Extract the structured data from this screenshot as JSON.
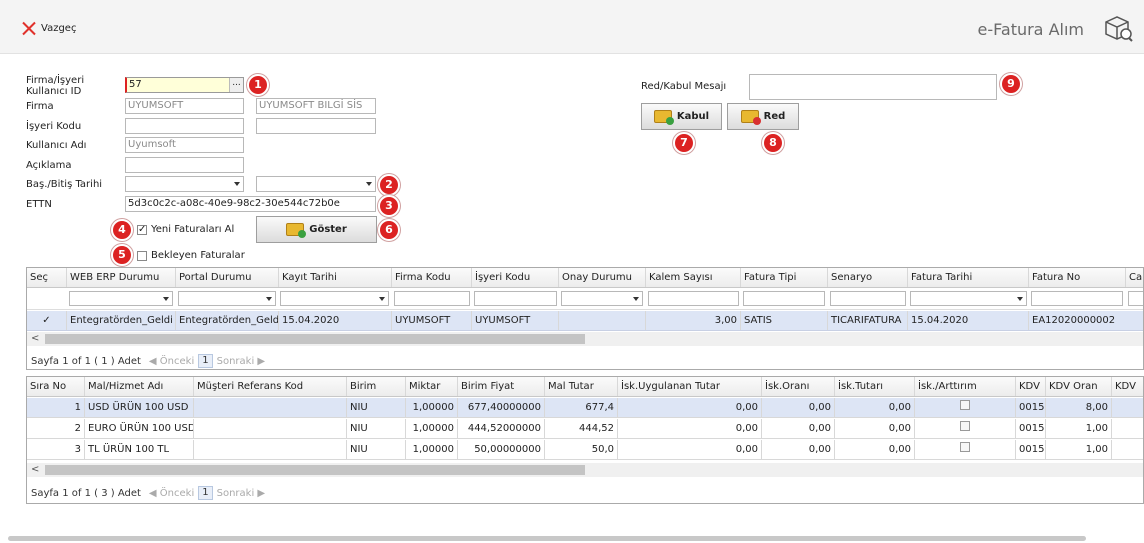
{
  "toolbar": {
    "cancel_label": "Vazgeç",
    "title": "e-Fatura Alım"
  },
  "form": {
    "firma_isyeri_label": "Firma/İşyeri Kullanıcı ID",
    "firma_isyeri_value": "57",
    "firma_label": "Firma",
    "firma_code": "UYUMSOFT",
    "firma_name": "UYUMSOFT BILGİ SİS",
    "isyeri_label": "İşyeri Kodu",
    "kullanici_label": "Kullanıcı Adı",
    "kullanici_value": "Uyumsoft",
    "aciklama_label": "Açıklama",
    "tarih_label": "Baş./Bitiş Tarihi",
    "ettn_label": "ETTN",
    "ettn_value": "5d3c0c2c-a08c-40e9-98c2-30e544c72b0e",
    "yeni_label": "Yeni Faturaları Al",
    "yeni_checked": "✓",
    "bekleyen_label": "Bekleyen Faturalar",
    "goster_label": "Göster",
    "mesaj_label": "Red/Kabul Mesajı",
    "kabul_label": "Kabul",
    "red_label": "Red"
  },
  "badges": [
    "1",
    "2",
    "3",
    "4",
    "5",
    "6",
    "7",
    "8",
    "9"
  ],
  "grid1": {
    "headers": [
      "Seç",
      "WEB ERP Durumu",
      "Portal Durumu",
      "Kayıt Tarihi",
      "Firma Kodu",
      "İşyeri Kodu",
      "Onay Durumu",
      "Kalem Sayısı",
      "Fatura Tipi",
      "Senaryo",
      "Fatura Tarihi",
      "Fatura No",
      "Ca"
    ],
    "row": {
      "sec": "✓",
      "web_erp": "Entegratörden_Geldi",
      "portal": "Entegratörden_Geldi",
      "kayit_tarihi": "15.04.2020",
      "firma_kodu": "UYUMSOFT",
      "isyeri_kodu": "UYUMSOFT",
      "onay": "",
      "kalem": "3,00",
      "tip": "SATIS",
      "senaryo": "TICARIFATURA",
      "fatura_tarihi": "15.04.2020",
      "fatura_no": "EA12020000002"
    },
    "pager": {
      "text": "Sayfa 1 of 1 ( 1 ) Adet",
      "prev": "Önceki",
      "page": "1",
      "next": "Sonraki"
    }
  },
  "grid2": {
    "headers": [
      "Sıra No",
      "Mal/Hizmet Adı",
      "Müşteri Referans Kod",
      "Birim",
      "Miktar",
      "Birim Fiyat",
      "Mal Tutar",
      "İsk.Uygulanan Tutar",
      "İsk.Oranı",
      "İsk.Tutarı",
      "İsk./Arttırım",
      "KDV",
      "KDV Oran",
      "KDV"
    ],
    "rows": [
      {
        "sira": "1",
        "ad": "USD ÜRÜN 100 USD",
        "ref": "",
        "birim": "NIU",
        "miktar": "1,00000",
        "fiyat": "677,40000000",
        "tutar": "677,4",
        "isk_uyg": "0,00",
        "isk_oran": "0,00",
        "isk_tutar": "0,00",
        "kdv": "0015",
        "kdv_oran": "8,00"
      },
      {
        "sira": "2",
        "ad": "EURO ÜRÜN 100 USD",
        "ref": "",
        "birim": "NIU",
        "miktar": "1,00000",
        "fiyat": "444,52000000",
        "tutar": "444,52",
        "isk_uyg": "0,00",
        "isk_oran": "0,00",
        "isk_tutar": "0,00",
        "kdv": "0015",
        "kdv_oran": "1,00"
      },
      {
        "sira": "3",
        "ad": "TL ÜRÜN 100 TL",
        "ref": "",
        "birim": "NIU",
        "miktar": "1,00000",
        "fiyat": "50,00000000",
        "tutar": "50,0",
        "isk_uyg": "0,00",
        "isk_oran": "0,00",
        "isk_tutar": "0,00",
        "kdv": "0015",
        "kdv_oran": "1,00"
      }
    ],
    "pager": {
      "text": "Sayfa 1 of 1 ( 3 ) Adet",
      "prev": "Önceki",
      "page": "1",
      "next": "Sonraki"
    }
  },
  "colors": {
    "badge": "#dc2222",
    "selected_row": "#dde5f5",
    "highlight_input": "#ffffd9"
  }
}
